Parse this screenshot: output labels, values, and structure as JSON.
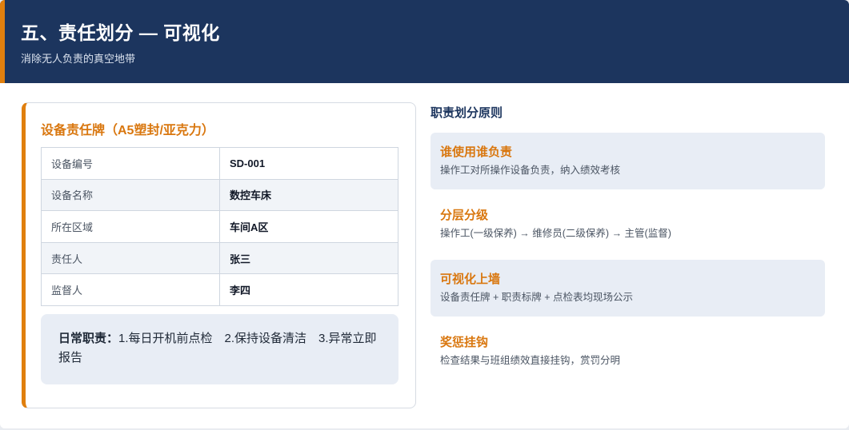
{
  "header": {
    "title": "五、责任划分 — 可视化",
    "subtitle": "消除无人负责的真空地带"
  },
  "card": {
    "title": "设备责任牌（A5塑封/亚克力）",
    "rows": [
      {
        "key": "设备编号",
        "value": "SD-001"
      },
      {
        "key": "设备名称",
        "value": "数控车床"
      },
      {
        "key": "所在区域",
        "value": "车间A区"
      },
      {
        "key": "责任人",
        "value": "张三"
      },
      {
        "key": "监督人",
        "value": "李四"
      }
    ],
    "duties_label": "日常职责：",
    "duties_text": "1.每日开机前点检　2.保持设备清洁　3.异常立即报告"
  },
  "principles": {
    "heading": "职责划分原则",
    "items": [
      {
        "title": "谁使用谁负责",
        "desc": "操作工对所操作设备负责，纳入绩效考核"
      },
      {
        "title": "分层分级",
        "desc": "操作工(一级保养) → 维修员(二级保养) → 主管(监督)"
      },
      {
        "title": "可视化上墙",
        "desc": "设备责任牌 + 职责标牌 + 点检表均现场公示"
      },
      {
        "title": "奖惩挂钩",
        "desc": "检查结果与班组绩效直接挂钩，赏罚分明"
      }
    ]
  },
  "colors": {
    "header_bg": "#1c355e",
    "accent": "#e07f0e",
    "shaded_bg": "#e8edf5"
  }
}
